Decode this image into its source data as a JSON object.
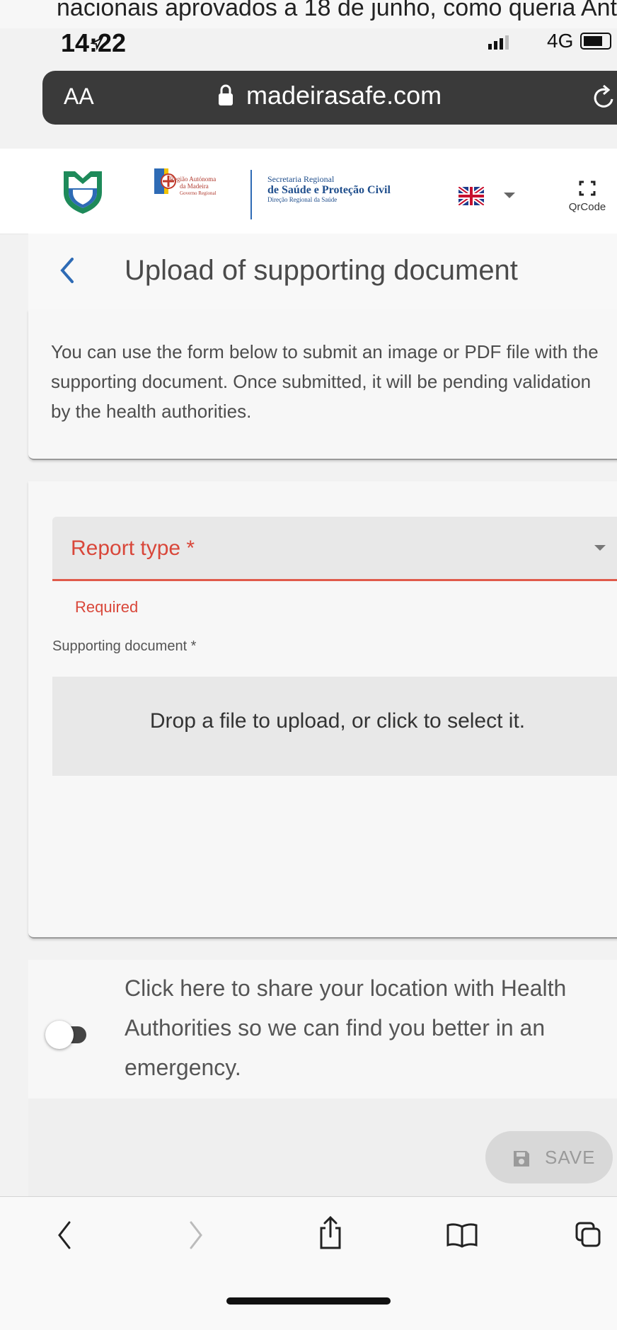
{
  "notification": {
    "text": "nacionais aprovados a 18 de junho, como queria Ant..."
  },
  "status_bar": {
    "time": "14:22",
    "network": "4G"
  },
  "browser": {
    "text_size_label": "AA",
    "url": "madeirasafe.com"
  },
  "header": {
    "raml_text": [
      "Região Autónoma",
      "da Madeira",
      "Governo Regional"
    ],
    "srspc_text": [
      "Secretaria Regional",
      "de Saúde e Proteção Civil",
      "Direção Regional da Saúde"
    ],
    "qrcode_label": "QrCode"
  },
  "page": {
    "title": "Upload of supporting document"
  },
  "intro": {
    "text": "You can use the form below to submit an image or PDF file with the supporting document. Once submitted, it will be pending validation by the health authorities."
  },
  "form": {
    "report_type_label": "Report type *",
    "required_error": "Required",
    "supporting_label": "Supporting document *",
    "dropzone_text": "Drop a file to upload, or click to select it."
  },
  "location": {
    "text": "Click here to share your location with Health Authorities so we can find you better in an emergency.",
    "enabled": false
  },
  "actions": {
    "save_label": "SAVE"
  },
  "colors": {
    "error": "#d9473a",
    "accent": "#2e6bb5",
    "logo_green": "#1e8a5a",
    "logo_blue": "#2e6bb5"
  }
}
